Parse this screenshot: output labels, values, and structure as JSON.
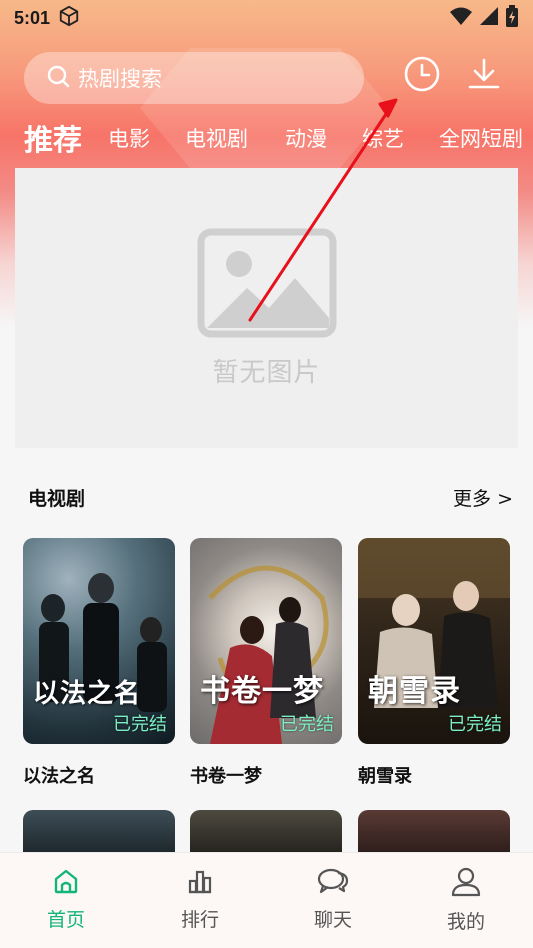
{
  "status": {
    "time": "5:01"
  },
  "search": {
    "placeholder": "热剧搜索"
  },
  "tabs": [
    {
      "label": "推荐",
      "active": true
    },
    {
      "label": "电影"
    },
    {
      "label": "电视剧"
    },
    {
      "label": "动漫"
    },
    {
      "label": "综艺"
    },
    {
      "label": "全网短剧"
    }
  ],
  "banner": {
    "placeholder_text": "暂无图片"
  },
  "section": {
    "title": "电视剧",
    "more": "更多 >"
  },
  "cards": [
    {
      "name": "以法之名",
      "badge": "已完结",
      "art_text": "以法之名"
    },
    {
      "name": "书卷一梦",
      "badge": "已完结",
      "art_text": "书卷一梦"
    },
    {
      "name": "朝雪录",
      "badge": "已完结",
      "art_text": "朝雪录"
    }
  ],
  "nav": [
    {
      "label": "首页",
      "icon": "home-icon",
      "active": true
    },
    {
      "label": "排行",
      "icon": "ranking-icon"
    },
    {
      "label": "聊天",
      "icon": "chat-icon"
    },
    {
      "label": "我的",
      "icon": "profile-icon"
    }
  ],
  "colors": {
    "accent": "#13b57a",
    "badge": "#7cf0c4",
    "arrow": "#e8101a"
  }
}
